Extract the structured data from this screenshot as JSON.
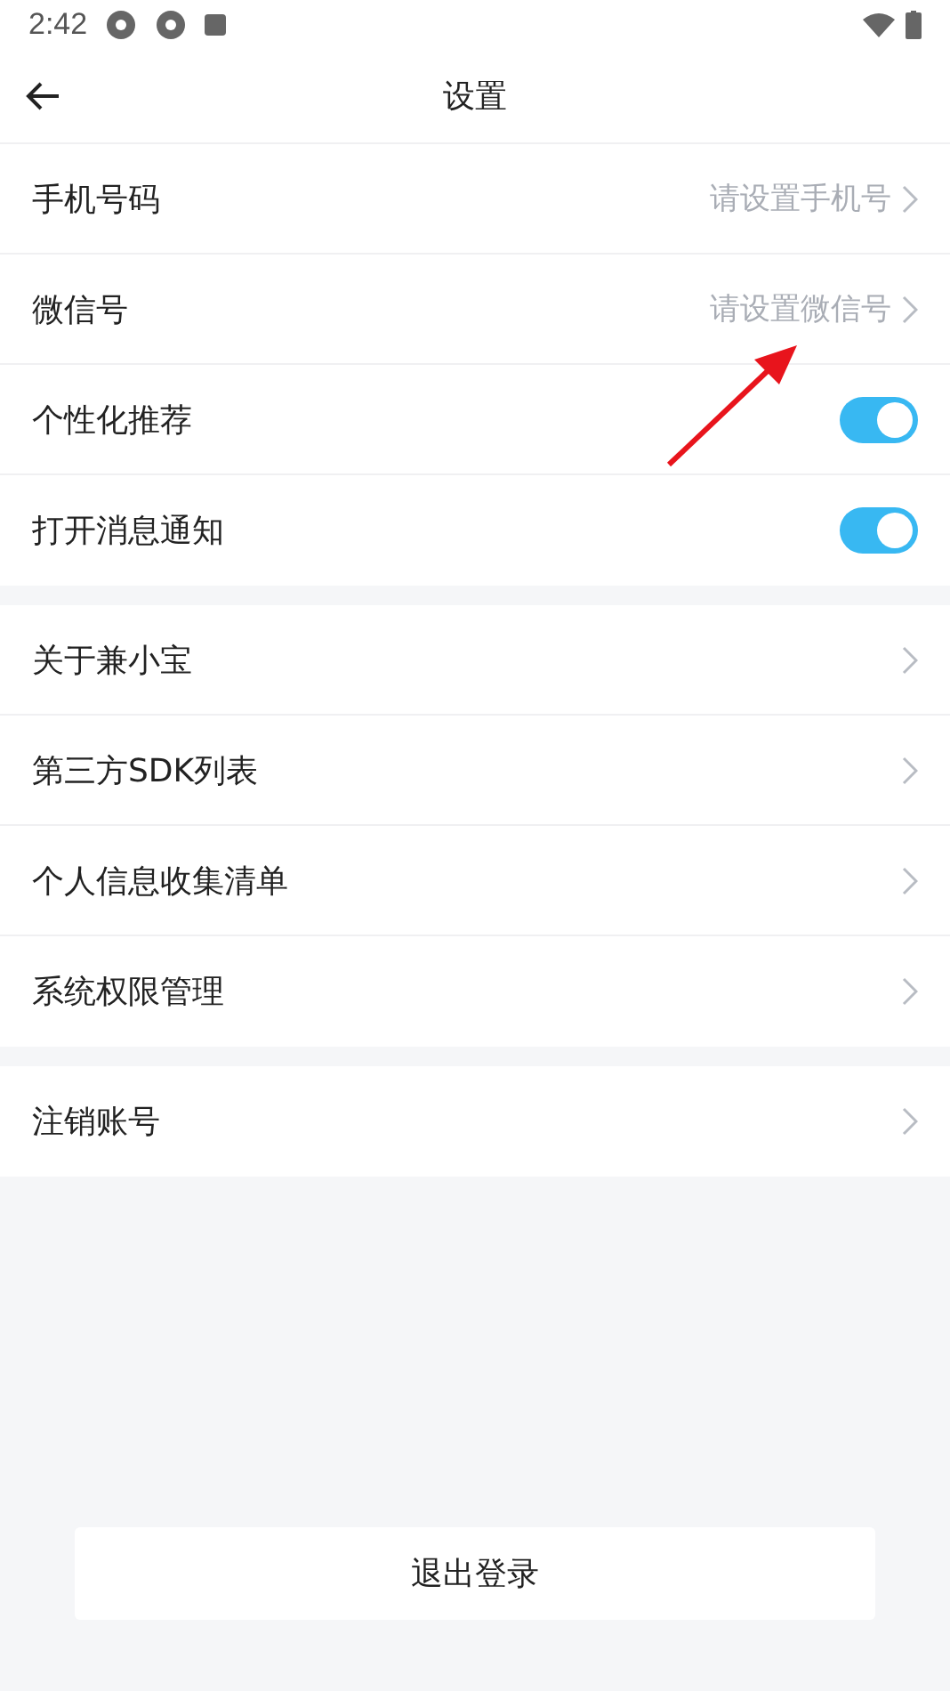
{
  "status_bar": {
    "time": "2:42"
  },
  "header": {
    "title": "设置"
  },
  "groups": [
    {
      "rows": [
        {
          "kind": "link",
          "label": "手机号码",
          "value": "请设置手机号"
        },
        {
          "kind": "link",
          "label": "微信号",
          "value": "请设置微信号"
        },
        {
          "kind": "toggle",
          "label": "个性化推荐",
          "on": true
        },
        {
          "kind": "toggle",
          "label": "打开消息通知",
          "on": true
        }
      ]
    },
    {
      "rows": [
        {
          "kind": "link",
          "label": "关于兼小宝"
        },
        {
          "kind": "link",
          "label": "第三方SDK列表"
        },
        {
          "kind": "link",
          "label": "个人信息收集清单"
        },
        {
          "kind": "link",
          "label": "系统权限管理"
        }
      ]
    },
    {
      "rows": [
        {
          "kind": "link",
          "label": "注销账号"
        }
      ]
    }
  ],
  "logout_button": "退出登录"
}
